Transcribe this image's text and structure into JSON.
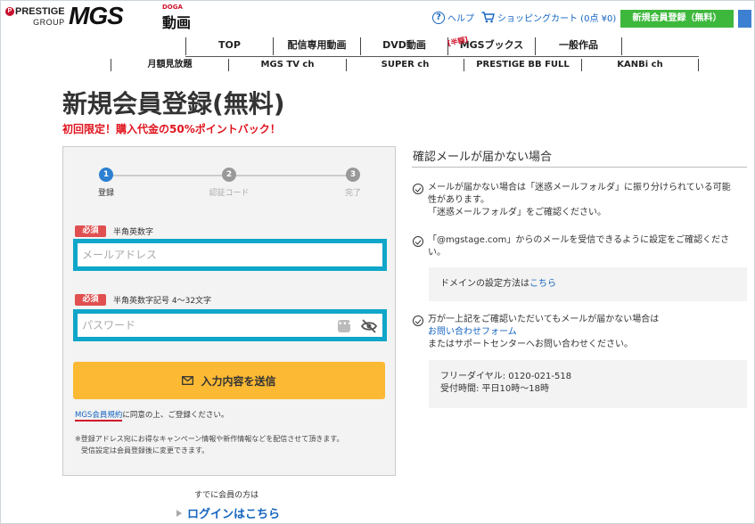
{
  "header": {
    "logo_prestige": "PRESTIGE",
    "logo_group": "GROUP",
    "logo_mgs": "MGS",
    "logo_doga": "DOGA",
    "logo_douga": "動画",
    "help_label": "ヘルプ",
    "cart_label": "ショッピングカート (0点 ¥0)",
    "register_label": "新規会員登録（無料）"
  },
  "nav_primary": [
    {
      "label": "TOP"
    },
    {
      "label": "配信専用動画"
    },
    {
      "label": "DVD動画"
    },
    {
      "label": "MGSブックス",
      "tag": "[半額]"
    },
    {
      "label": "一般作品"
    }
  ],
  "nav_secondary": [
    {
      "label": "月額見放題"
    },
    {
      "label": "MGS TV ch"
    },
    {
      "label": "SUPER ch"
    },
    {
      "label": "PRESTIGE BB FULL"
    },
    {
      "label": "KANBi ch"
    }
  ],
  "page": {
    "title": "新規会員登録(無料)",
    "promo": "初回限定！購入代金の50%ポイントバック！"
  },
  "steps": [
    {
      "num": "1",
      "label": "登録",
      "active": true
    },
    {
      "num": "2",
      "label": "認証コード",
      "active": false
    },
    {
      "num": "3",
      "label": "完了",
      "active": false
    }
  ],
  "form": {
    "required_badge": "必須",
    "email_desc": "半角英数字",
    "email_placeholder": "メールアドレス",
    "email_value": "",
    "password_desc": "半角英数字記号 4～32文字",
    "password_placeholder": "パスワード",
    "password_value": "",
    "submit_label": "入力内容を送信",
    "terms_link": "MGS会員規約",
    "terms_text": "に同意の上、ご登録ください。",
    "notice_line1": "※登録アドレス宛にお得なキャンペーン情報や新作情報などを配信させて頂きます。",
    "notice_line2": "受信設定は会員登録後に変更できます。",
    "already_member": "すでに会員の方は",
    "login_link": "ログインはこちら"
  },
  "help": {
    "title": "確認メールが届かない場合",
    "item1_line1": "メールが届かない場合は「迷惑メールフォルダ」に振り分けられている可能",
    "item1_line2": "性があります。",
    "item1_line3": "「迷惑メールフォルダ」をご確認ください。",
    "item2_line1": "「@mgstage.com」からのメールを受信できるように設定をご確認くださ",
    "item2_line2": "い。",
    "domain_text": "ドメインの設定方法は",
    "domain_link": "こちら",
    "item3_line1": "万が一上記をご確認いただいてもメールが届かない場合は",
    "item3_link": "お問い合わせフォーム",
    "item3_line3": "またはサポートセンターへお問い合わせください。",
    "phone": "フリーダイヤル: 0120-021-518",
    "hours": "受付時間: 平日10時～18時"
  },
  "colors": {
    "input_highlight": "#0fa6c9",
    "submit_bg": "#fbb934",
    "register_bg": "#3db83d",
    "promo_red": "#e0141e",
    "step_active": "#2d7fd0"
  }
}
